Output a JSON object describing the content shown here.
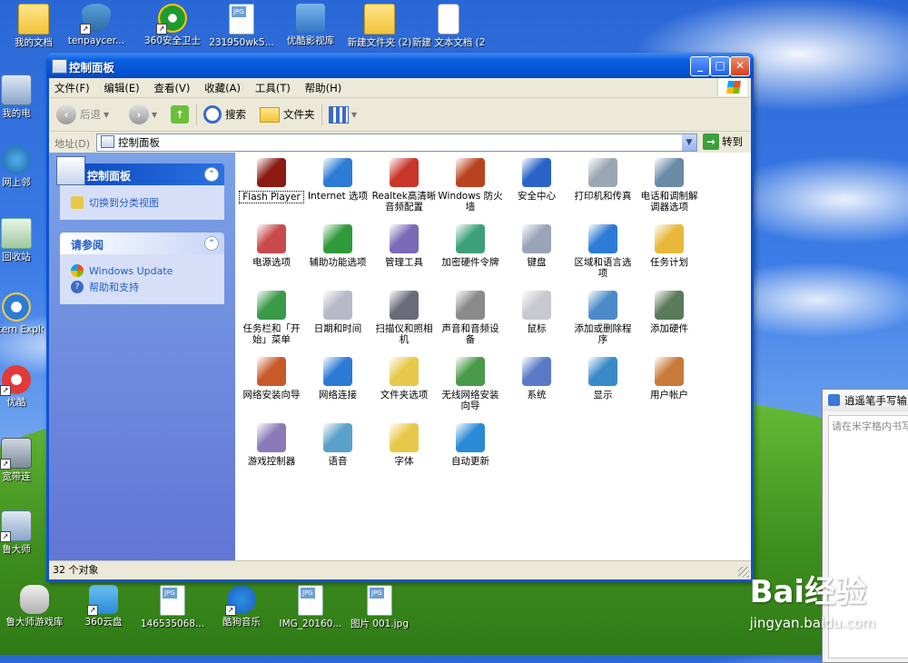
{
  "desktop": {
    "top_icons": [
      {
        "label": "我的文档",
        "icon": "folder-icon"
      },
      {
        "label": "tenpaycer...",
        "icon": "shield-icon"
      },
      {
        "label": "360安全卫士",
        "icon": "360-icon"
      },
      {
        "label": "231950wk5...",
        "icon": "jpg-file-icon"
      },
      {
        "label": "优酷影视库",
        "icon": "youku-icon"
      },
      {
        "label": "新建文件夹 (2)",
        "icon": "folder-icon"
      },
      {
        "label": "新建 文本文档 (2).txt",
        "icon": "text-file-icon"
      }
    ],
    "left_icons": [
      {
        "label": "我的电",
        "icon": "computer-icon"
      },
      {
        "label": "网上邻",
        "icon": "network-icon"
      },
      {
        "label": "回收站",
        "icon": "recycle-bin-icon"
      },
      {
        "label": "Intern Explor",
        "icon": "ie-icon"
      },
      {
        "label": "优酷",
        "icon": "video-icon"
      },
      {
        "label": "宽带连",
        "icon": "broadband-icon"
      },
      {
        "label": "鲁大师",
        "icon": "ludashi-icon"
      }
    ],
    "bottom_icons": [
      {
        "label": "鲁大师游戏库",
        "icon": "gamepad-icon"
      },
      {
        "label": "360云盘",
        "icon": "cloud-icon"
      },
      {
        "label": "146535068...",
        "icon": "jpg-file-icon"
      },
      {
        "label": "酷狗音乐",
        "icon": "kugou-icon"
      },
      {
        "label": "IMG_20160...",
        "icon": "jpg-file-icon"
      },
      {
        "label": "图片 001.jpg",
        "icon": "jpg-file-icon"
      }
    ]
  },
  "window": {
    "title": "控制面板",
    "menu": [
      "文件(F)",
      "编辑(E)",
      "查看(V)",
      "收藏(A)",
      "工具(T)",
      "帮助(H)"
    ],
    "toolbar": {
      "back": "后退",
      "search": "搜索",
      "folders": "文件夹"
    },
    "address": {
      "label": "地址(D)",
      "value": "控制面板",
      "go": "转到"
    },
    "sidebar": {
      "panel1_title": "控制面板",
      "panel1_link": "切换到分类视图",
      "panel2_title": "请参阅",
      "panel2_links": [
        "Windows Update",
        "帮助和支持"
      ]
    },
    "items": [
      {
        "label": "Flash Player",
        "color": "#8a1a12"
      },
      {
        "label": "Internet 选项",
        "color": "#2c7bd6"
      },
      {
        "label": "Realtek高清晰音频配置",
        "color": "#c8362a"
      },
      {
        "label": "Windows 防火墙",
        "color": "#b8431f"
      },
      {
        "label": "安全中心",
        "color": "#2a62c8"
      },
      {
        "label": "打印机和传真",
        "color": "#9aa6b2"
      },
      {
        "label": "电话和调制解调器选项",
        "color": "#6a8aa8"
      },
      {
        "label": "电源选项",
        "color": "#c84a4a"
      },
      {
        "label": "辅助功能选项",
        "color": "#2f9a3a"
      },
      {
        "label": "管理工具",
        "color": "#7a6ab8"
      },
      {
        "label": "加密硬件令牌",
        "color": "#3ca07a"
      },
      {
        "label": "键盘",
        "color": "#9aa4b8"
      },
      {
        "label": "区域和语言选项",
        "color": "#2c7bd6"
      },
      {
        "label": "任务计划",
        "color": "#e8b83a"
      },
      {
        "label": "任务栏和「开始」菜单",
        "color": "#3a9a4a"
      },
      {
        "label": "日期和时间",
        "color": "#b8b8c8"
      },
      {
        "label": "扫描仪和照相机",
        "color": "#6a6a7a"
      },
      {
        "label": "声音和音频设备",
        "color": "#8a8a8a"
      },
      {
        "label": "鼠标",
        "color": "#c8c8d0"
      },
      {
        "label": "添加或删除程序",
        "color": "#4a8ac8"
      },
      {
        "label": "添加硬件",
        "color": "#5a7a5a"
      },
      {
        "label": "网络安装向导",
        "color": "#c85a2a"
      },
      {
        "label": "网络连接",
        "color": "#2a7ad6"
      },
      {
        "label": "文件夹选项",
        "color": "#e8c84a"
      },
      {
        "label": "无线网络安装向导",
        "color": "#4a9a4a"
      },
      {
        "label": "系统",
        "color": "#5a7ac8"
      },
      {
        "label": "显示",
        "color": "#3a8ac8"
      },
      {
        "label": "用户帐户",
        "color": "#c87a3a"
      },
      {
        "label": "游戏控制器",
        "color": "#8a7ab8"
      },
      {
        "label": "语音",
        "color": "#5aa0c8"
      },
      {
        "label": "字体",
        "color": "#e8c84a"
      },
      {
        "label": "自动更新",
        "color": "#2a8ad6"
      }
    ],
    "status": "32 个对象"
  },
  "side_window": {
    "title": "逍遥笔手写输入",
    "placeholder": "请在米字格内书写"
  },
  "watermark": {
    "brand": "Bai经验",
    "url": "jingyan.baidu.com"
  }
}
